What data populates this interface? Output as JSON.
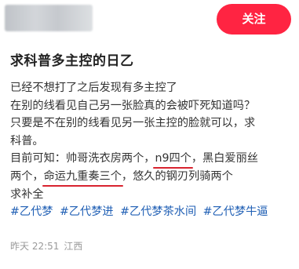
{
  "header": {
    "follow_label": "关注"
  },
  "post": {
    "title": "求科普多主控的日乙",
    "lines": [
      "已经不想打了之后发现有多主控了",
      "在别的线看见自己另一张脸真的会被吓死知道吗？",
      "只要是不在别的线看见另一张主控的脸就可以，求",
      "科普。"
    ],
    "known": {
      "prefix": "目前可知：帅哥洗衣房两个，",
      "highlight1": "n9四个",
      "middle": "，黑白爱丽丝",
      "line2_prefix": "两个，",
      "highlight2": "命运九重奏三个",
      "line2_suffix": "，悠久的钢刃列骑两个"
    },
    "closing": "求补全",
    "tags": [
      "#乙代梦",
      "#乙代梦进",
      "#乙代梦茶水间",
      "#乙代梦牛逼"
    ]
  },
  "meta": {
    "time": "昨天 22:51",
    "location": "江西"
  },
  "colors": {
    "accent": "#ff2442",
    "tag": "#1e5eb4",
    "underline": "#d8232f"
  }
}
